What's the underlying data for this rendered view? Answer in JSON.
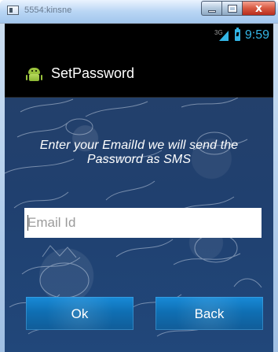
{
  "window": {
    "title": "5554:kinsne",
    "controls": {
      "close_glyph": "x"
    }
  },
  "statusbar": {
    "network": "3G",
    "time": "9:59",
    "accent": "#33b5e5"
  },
  "actionbar": {
    "title": "SetPassword",
    "icon": "android-icon"
  },
  "form": {
    "instruction": "Enter your EmailId we will send the Password as SMS",
    "email_placeholder": "Email Id",
    "ok_label": "Ok",
    "back_label": "Back"
  },
  "icons": {
    "window_icon": "window-icon",
    "signal": "signal-icon",
    "battery": "battery-icon"
  }
}
